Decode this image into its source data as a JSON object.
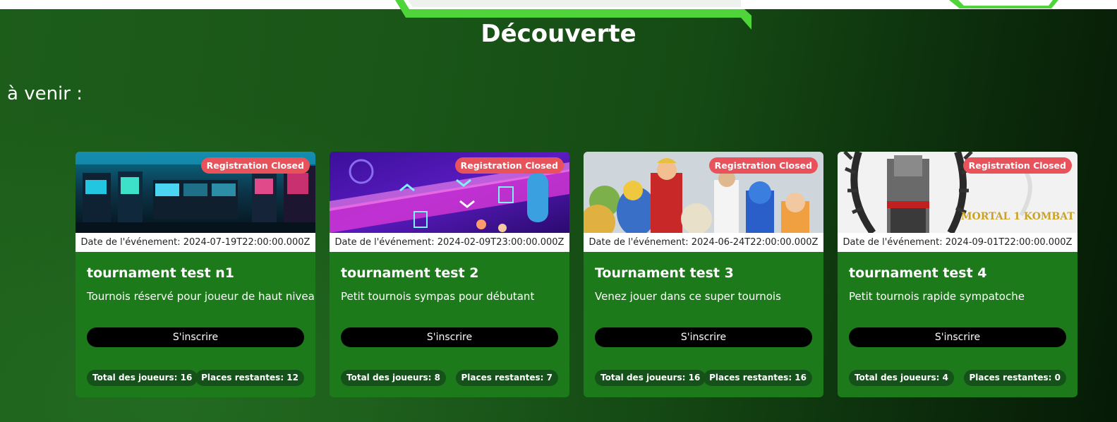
{
  "page": {
    "title": "Découverte",
    "section_title": "à venir :"
  },
  "tournaments": [
    {
      "status_badge": "Registration Closed",
      "date_text": "Date de l'événement: 2024-07-19T22:00:00.000Z",
      "title": "tournament test n1",
      "description": "Tournois réservé pour joueur de haut niveau",
      "signup_label": "S'inscrire",
      "total_players": "Total des joueurs: 16",
      "remaining_places": "Places restantes: 12",
      "image": "arcade-room"
    },
    {
      "status_badge": "Registration Closed",
      "date_text": "Date de l'événement: 2024-02-09T23:00:00.000Z",
      "title": "tournament test 2",
      "description": "Petit tournois sympas pour débutant",
      "signup_label": "S'inscrire",
      "total_players": "Total des joueurs: 8",
      "remaining_places": "Places restantes: 7",
      "image": "neon-rhythm-game"
    },
    {
      "status_badge": "Registration Closed",
      "date_text": "Date de l'événement: 2024-06-24T22:00:00.000Z",
      "title": "Tournament test 3",
      "description": "Venez jouer dans ce super tournois",
      "signup_label": "S'inscrire",
      "total_players": "Total des joueurs: 16",
      "remaining_places": "Places restantes: 16",
      "image": "fighter-figurines"
    },
    {
      "status_badge": "Registration Closed",
      "date_text": "Date de l'événement: 2024-09-01T22:00:00.000Z",
      "title": "tournament test 4",
      "description": "Petit tournois rapide sympatoche",
      "signup_label": "S'inscrire",
      "total_players": "Total des joueurs: 4",
      "remaining_places": "Places restantes: 0",
      "image": "mortal-kombat",
      "image_logo_text": "MORTAL 1 KOMBAT"
    }
  ],
  "colors": {
    "card_bg": "#1c7a1a",
    "badge_bg": "#e8525a",
    "pill_bg": "#14521a",
    "button_bg": "#000000",
    "accent_green": "#4fd43a"
  }
}
